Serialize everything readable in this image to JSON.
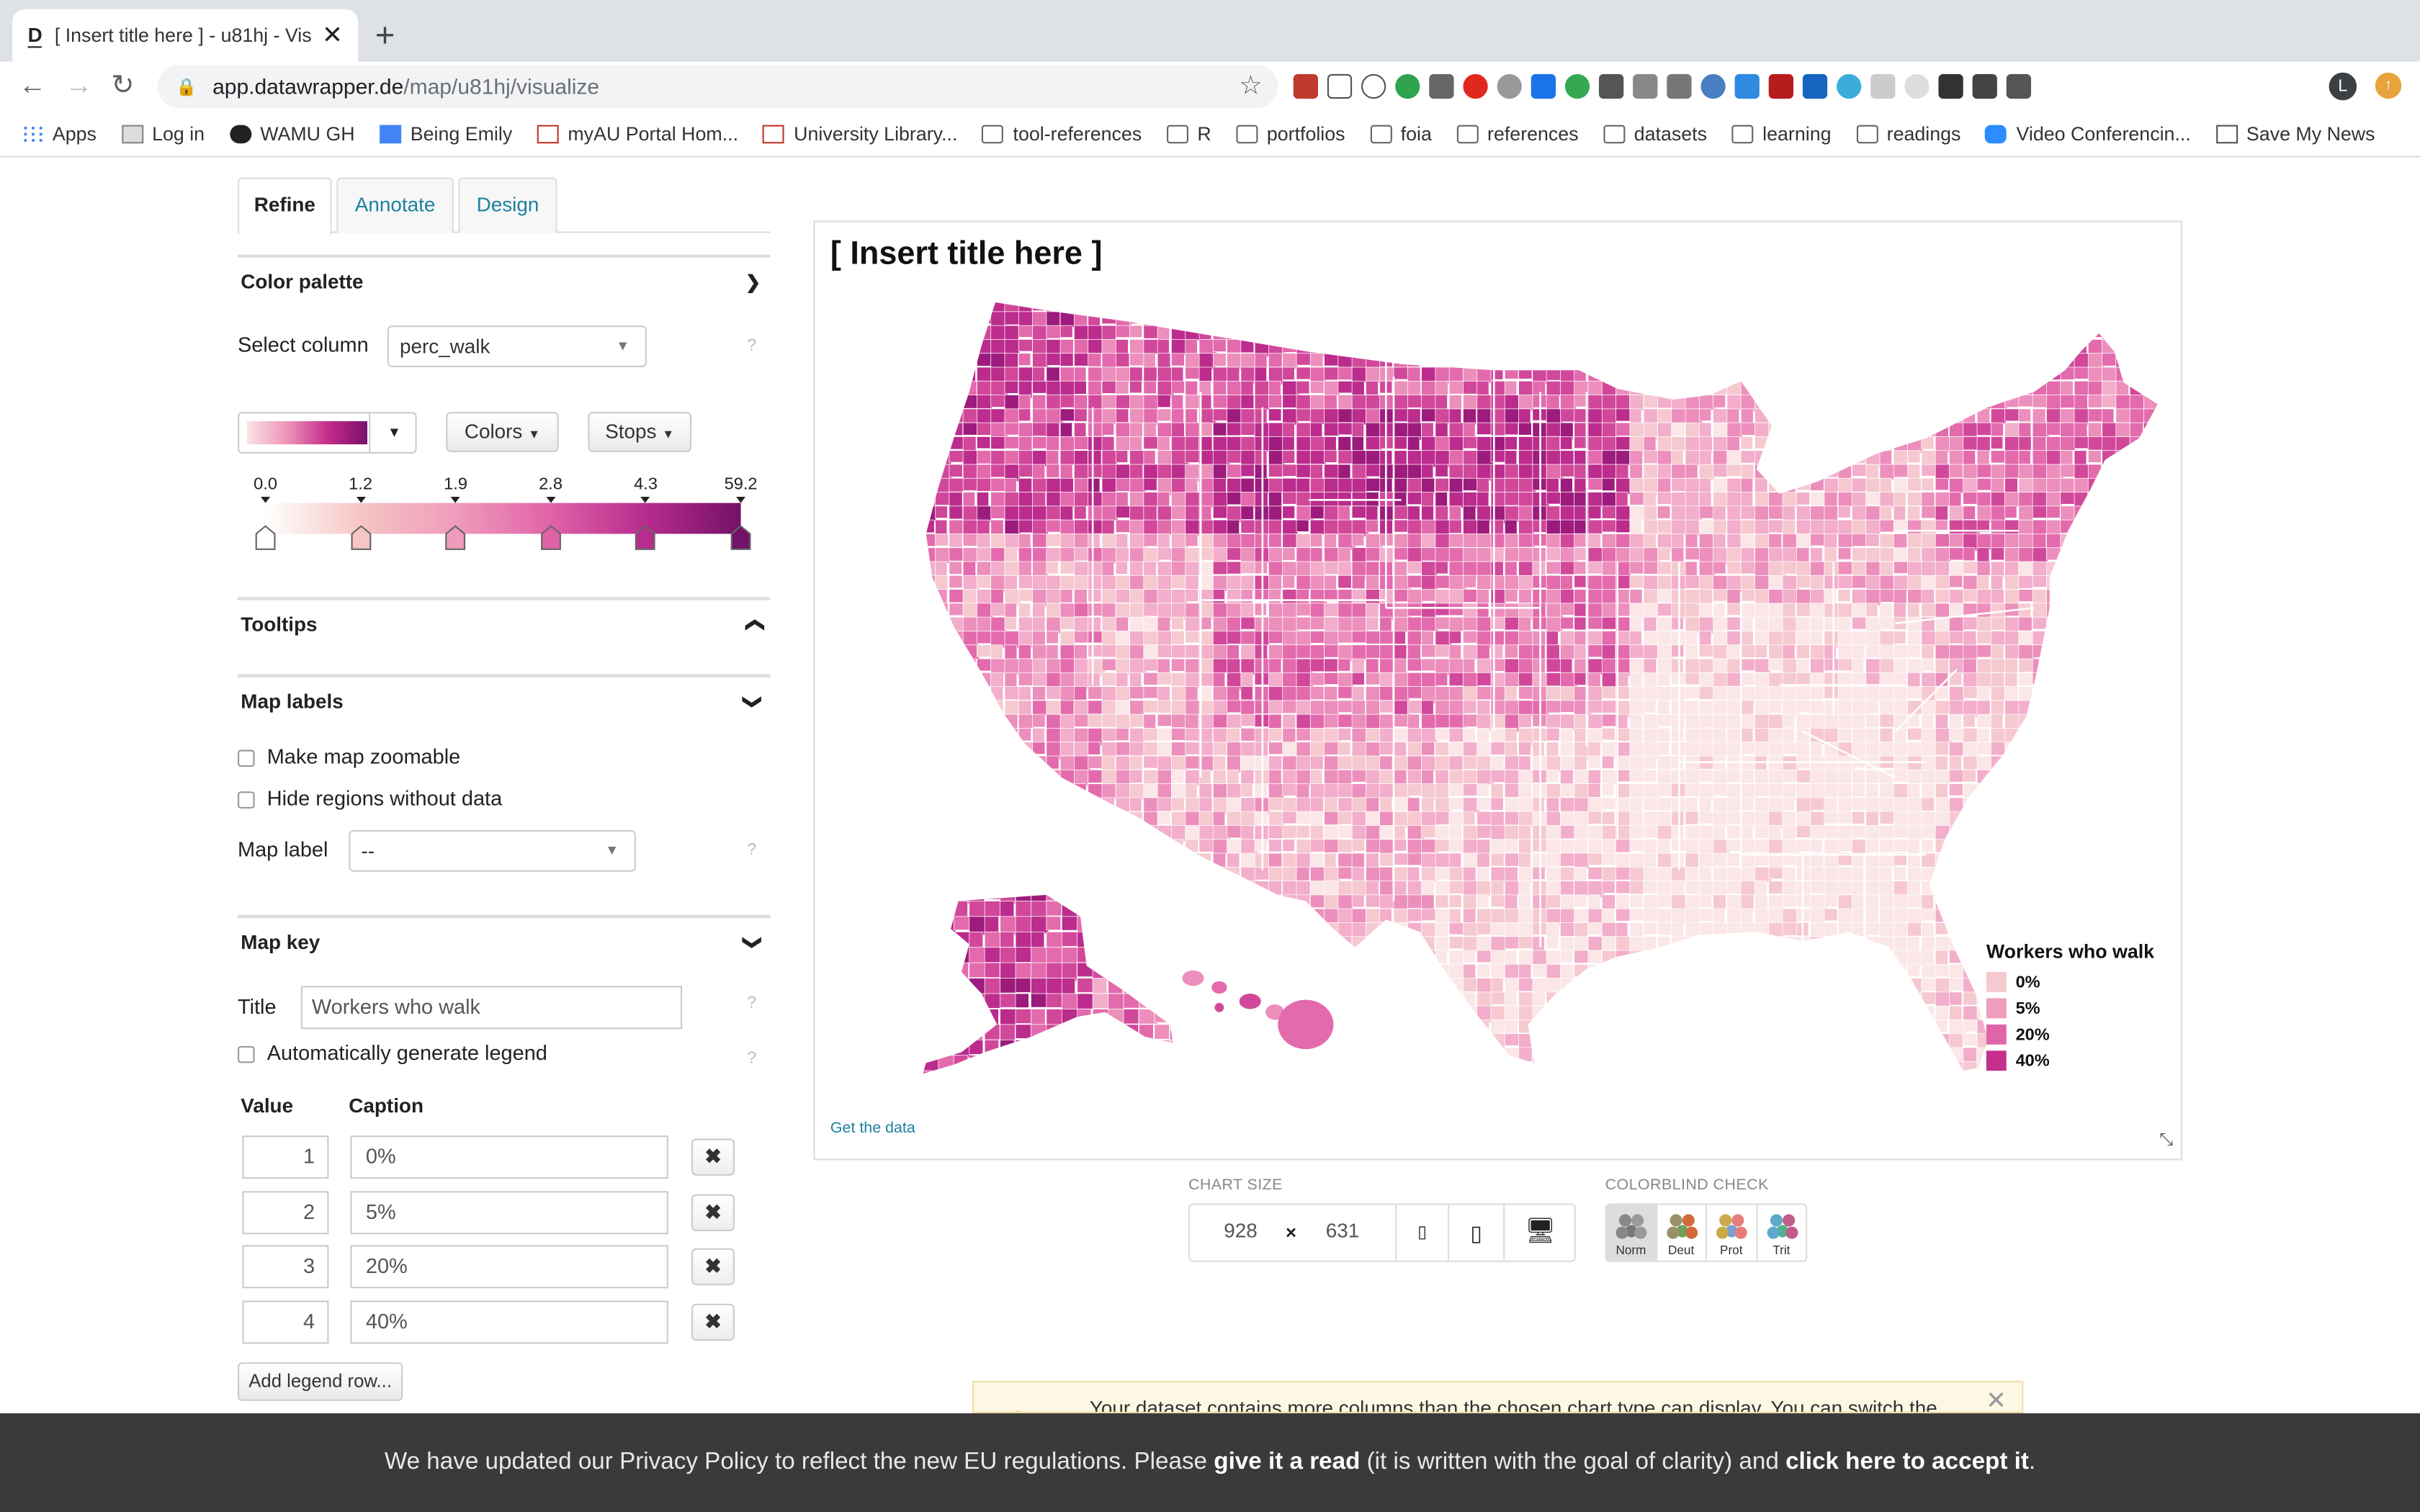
{
  "browser": {
    "tab_title": "[ Insert title here ] - u81hj - Vis",
    "favicon": "D",
    "url_host": "app.datawrapper.de",
    "url_path": "/map/u81hj/visualize",
    "bookmarks": [
      {
        "label": "Apps",
        "icon": "apps-grid"
      },
      {
        "label": "Log in",
        "icon": "page"
      },
      {
        "label": "WAMU GH",
        "icon": "github"
      },
      {
        "label": "Being Emily",
        "icon": "doc"
      },
      {
        "label": "myAU Portal Hom...",
        "icon": "au"
      },
      {
        "label": "University Library...",
        "icon": "au"
      },
      {
        "label": "tool-references",
        "icon": "folder"
      },
      {
        "label": "R",
        "icon": "folder"
      },
      {
        "label": "portfolios",
        "icon": "folder"
      },
      {
        "label": "foia",
        "icon": "folder"
      },
      {
        "label": "references",
        "icon": "folder"
      },
      {
        "label": "datasets",
        "icon": "folder"
      },
      {
        "label": "learning",
        "icon": "folder"
      },
      {
        "label": "readings",
        "icon": "folder"
      },
      {
        "label": "Video Conferencin...",
        "icon": "zoom"
      },
      {
        "label": "Save My News",
        "icon": "news"
      }
    ],
    "profile_initial": "L"
  },
  "panel": {
    "tabs": [
      "Refine",
      "Annotate",
      "Design"
    ],
    "active_tab": "Refine",
    "color_palette": {
      "heading": "Color palette",
      "select_column_label": "Select column",
      "select_column_value": "perc_walk",
      "colors_button": "Colors",
      "stops_button": "Stops",
      "stops": [
        "0.0",
        "1.2",
        "1.9",
        "2.8",
        "4.3",
        "59.2"
      ],
      "stop_colors": [
        "#ffffff",
        "#f6c5c5",
        "#ef9bbb",
        "#e063a8",
        "#b72c8e",
        "#741169"
      ]
    },
    "tooltips": {
      "heading": "Tooltips"
    },
    "map_labels": {
      "heading": "Map labels",
      "zoomable_label": "Make map zoomable",
      "hide_regions_label": "Hide regions without data",
      "map_label_label": "Map label",
      "map_label_value": "--"
    },
    "map_key": {
      "heading": "Map key",
      "title_label": "Title",
      "title_value": "Workers who walk",
      "auto_legend_label": "Automatically generate legend",
      "value_header": "Value",
      "caption_header": "Caption",
      "rows": [
        {
          "value": "1",
          "caption": "0%"
        },
        {
          "value": "2",
          "caption": "5%"
        },
        {
          "value": "3",
          "caption": "20%"
        },
        {
          "value": "4",
          "caption": "40%"
        }
      ],
      "add_row_button": "Add legend row...",
      "delete_glyph": "✖"
    },
    "help_glyph": "?"
  },
  "chart": {
    "title": "[ Insert title here ]",
    "get_data": "Get the data",
    "legend_title": "Workers who walk",
    "legend": [
      {
        "label": "0%",
        "color": "#f6c9d0"
      },
      {
        "label": "5%",
        "color": "#ee9dbd"
      },
      {
        "label": "20%",
        "color": "#e065a8"
      },
      {
        "label": "40%",
        "color": "#c52f8d"
      }
    ]
  },
  "chart_size": {
    "label": "CHART SIZE",
    "width": "928",
    "height": "631",
    "times": "×"
  },
  "colorblind": {
    "label": "COLORBLIND CHECK",
    "options": [
      "Norm",
      "Deut",
      "Prot",
      "Trit"
    ],
    "selected": "Norm"
  },
  "notice": {
    "text": "Your dataset contains more columns than the chosen chart type can display. You can switch the"
  },
  "privacy": {
    "part1": "We have updated our Privacy Policy to reflect the new EU regulations. Please ",
    "link1": "give it a read",
    "part2": " (it is written with the goal of clarity) and ",
    "link2": "click here to accept it",
    "part3": "."
  },
  "map_palette": [
    "#fbe6e8",
    "#f6c9d0",
    "#f2aecb",
    "#ec8fbc",
    "#e36bad",
    "#d1489b",
    "#bb2c8d",
    "#9c1b7c"
  ]
}
